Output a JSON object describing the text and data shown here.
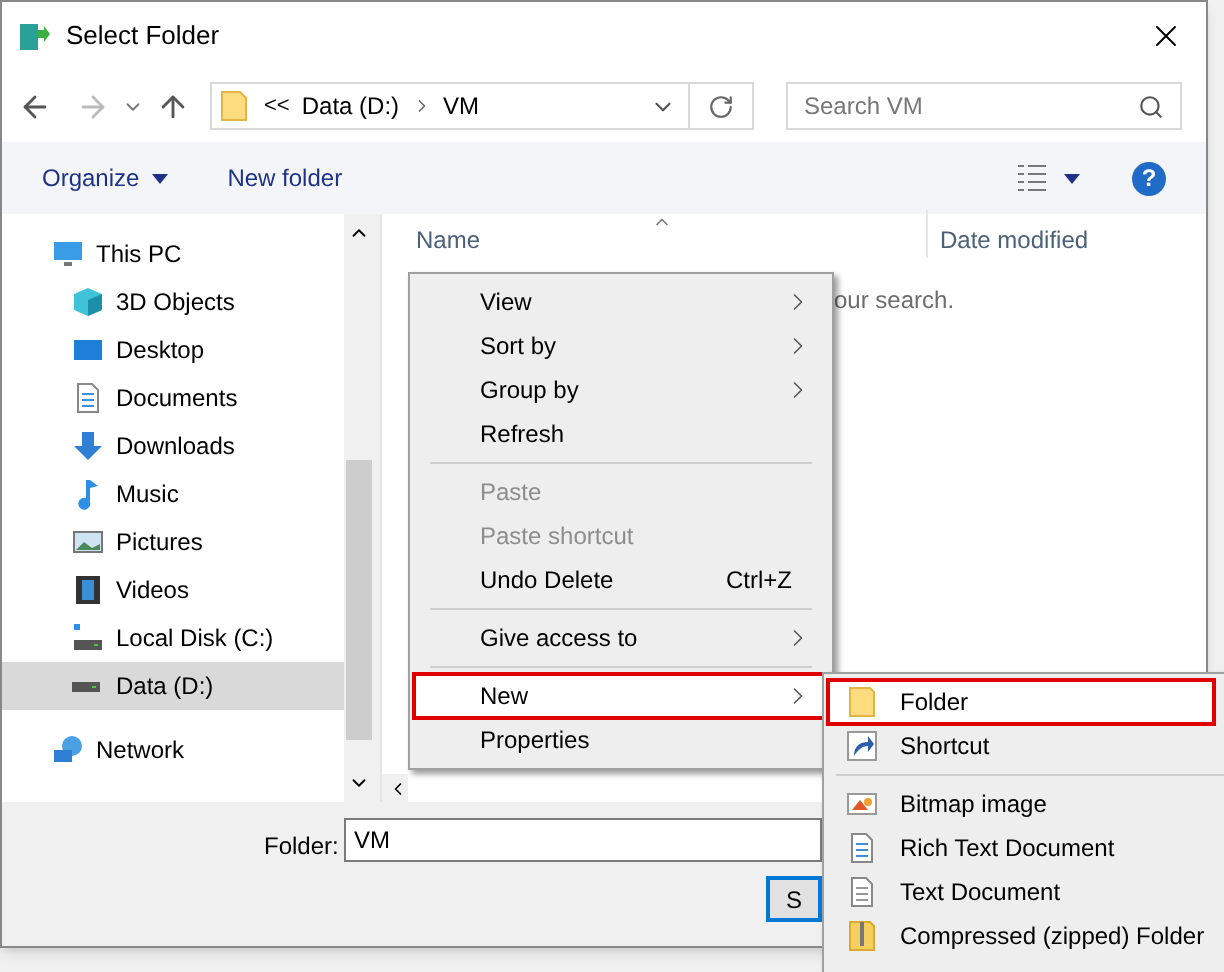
{
  "window": {
    "title": "Select Folder"
  },
  "address": {
    "overflow": "<<",
    "crumbs": [
      "Data (D:)",
      "VM"
    ]
  },
  "search": {
    "placeholder": "Search VM"
  },
  "toolbar": {
    "organize": "Organize",
    "new_folder": "New folder",
    "help": "?"
  },
  "nav": [
    {
      "label": "This PC",
      "kind": "pc",
      "selected": false,
      "children": [
        {
          "label": "3D Objects",
          "kind": "objects",
          "selected": false
        },
        {
          "label": "Desktop",
          "kind": "desktop",
          "selected": false
        },
        {
          "label": "Documents",
          "kind": "documents",
          "selected": false
        },
        {
          "label": "Downloads",
          "kind": "downloads",
          "selected": false
        },
        {
          "label": "Music",
          "kind": "music",
          "selected": false
        },
        {
          "label": "Pictures",
          "kind": "pictures",
          "selected": false
        },
        {
          "label": "Videos",
          "kind": "videos",
          "selected": false
        },
        {
          "label": "Local Disk (C:)",
          "kind": "system-disk",
          "selected": false
        },
        {
          "label": "Data (D:)",
          "kind": "disk",
          "selected": true
        }
      ]
    },
    {
      "label": "Network",
      "kind": "network",
      "selected": false
    }
  ],
  "columns": [
    "Name",
    "Date modified"
  ],
  "empty_message": "our search.",
  "folder_field": {
    "label": "Folder:",
    "value": "VM"
  },
  "select_button": "S",
  "context_menu": [
    {
      "kind": "item",
      "label": "View",
      "submenu": true,
      "disabled": false,
      "selected": false,
      "outlined": false
    },
    {
      "kind": "item",
      "label": "Sort by",
      "submenu": true,
      "disabled": false,
      "selected": false,
      "outlined": false
    },
    {
      "kind": "item",
      "label": "Group by",
      "submenu": true,
      "disabled": false,
      "selected": false,
      "outlined": false
    },
    {
      "kind": "item",
      "label": "Refresh",
      "submenu": false,
      "disabled": false,
      "selected": false,
      "outlined": false
    },
    {
      "kind": "separator"
    },
    {
      "kind": "item",
      "label": "Paste",
      "submenu": false,
      "disabled": true,
      "selected": false,
      "outlined": false
    },
    {
      "kind": "item",
      "label": "Paste shortcut",
      "submenu": false,
      "disabled": true,
      "selected": false,
      "outlined": false
    },
    {
      "kind": "item",
      "label": "Undo Delete",
      "shortcut": "Ctrl+Z",
      "submenu": false,
      "disabled": false,
      "selected": false,
      "outlined": false
    },
    {
      "kind": "separator"
    },
    {
      "kind": "item",
      "label": "Give access to",
      "submenu": true,
      "disabled": false,
      "selected": false,
      "outlined": false
    },
    {
      "kind": "separator"
    },
    {
      "kind": "item",
      "label": "New",
      "submenu": true,
      "disabled": false,
      "selected": true,
      "outlined": true
    },
    {
      "kind": "item",
      "label": "Properties",
      "submenu": false,
      "disabled": false,
      "selected": false,
      "outlined": false
    }
  ],
  "new_submenu": [
    {
      "kind": "folder",
      "label": "Folder",
      "selected": true,
      "outlined": true
    },
    {
      "kind": "shortcut",
      "label": "Shortcut",
      "selected": false,
      "outlined": false
    },
    {
      "kind": "separator"
    },
    {
      "kind": "bitmap",
      "label": "Bitmap image",
      "selected": false,
      "outlined": false
    },
    {
      "kind": "rich-text",
      "label": "Rich Text Document",
      "selected": false,
      "outlined": false
    },
    {
      "kind": "text",
      "label": "Text Document",
      "selected": false,
      "outlined": false
    },
    {
      "kind": "zip",
      "label": "Compressed (zipped) Folder",
      "selected": false,
      "outlined": false
    }
  ]
}
